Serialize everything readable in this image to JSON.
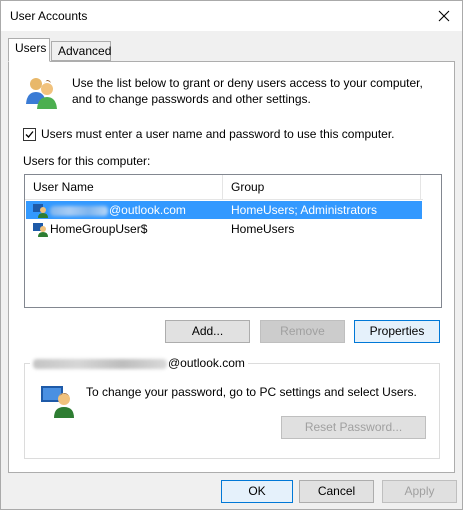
{
  "window": {
    "title": "User Accounts"
  },
  "tabs": [
    {
      "label": "Users",
      "active": true
    },
    {
      "label": "Advanced",
      "active": false
    }
  ],
  "intro_text": "Use the list below to grant or deny users access to your computer, and to change passwords and other settings.",
  "checkbox": {
    "label": "Users must enter a user name and password to use this computer.",
    "checked": true
  },
  "users_section_label": "Users for this computer:",
  "list": {
    "columns": [
      "User Name",
      "Group"
    ],
    "rows": [
      {
        "name_suffix": "@outlook.com",
        "group": "HomeUsers; Administrators",
        "selected": true
      },
      {
        "name": "HomeGroupUser$",
        "group": "HomeUsers",
        "selected": false
      }
    ]
  },
  "buttons": {
    "add": "Add...",
    "remove": "Remove",
    "properties": "Properties",
    "reset_password": "Reset Password...",
    "ok": "OK",
    "cancel": "Cancel",
    "apply": "Apply"
  },
  "password_group": {
    "title_suffix": "@outlook.com",
    "text": "To change your password, go to PC settings and select Users."
  },
  "colors": {
    "selection": "#3399ff",
    "focus_border": "#0078d7"
  },
  "icons": [
    "close-icon",
    "users-icon",
    "user-row-icon",
    "password-user-icon",
    "checkmark-icon"
  ]
}
